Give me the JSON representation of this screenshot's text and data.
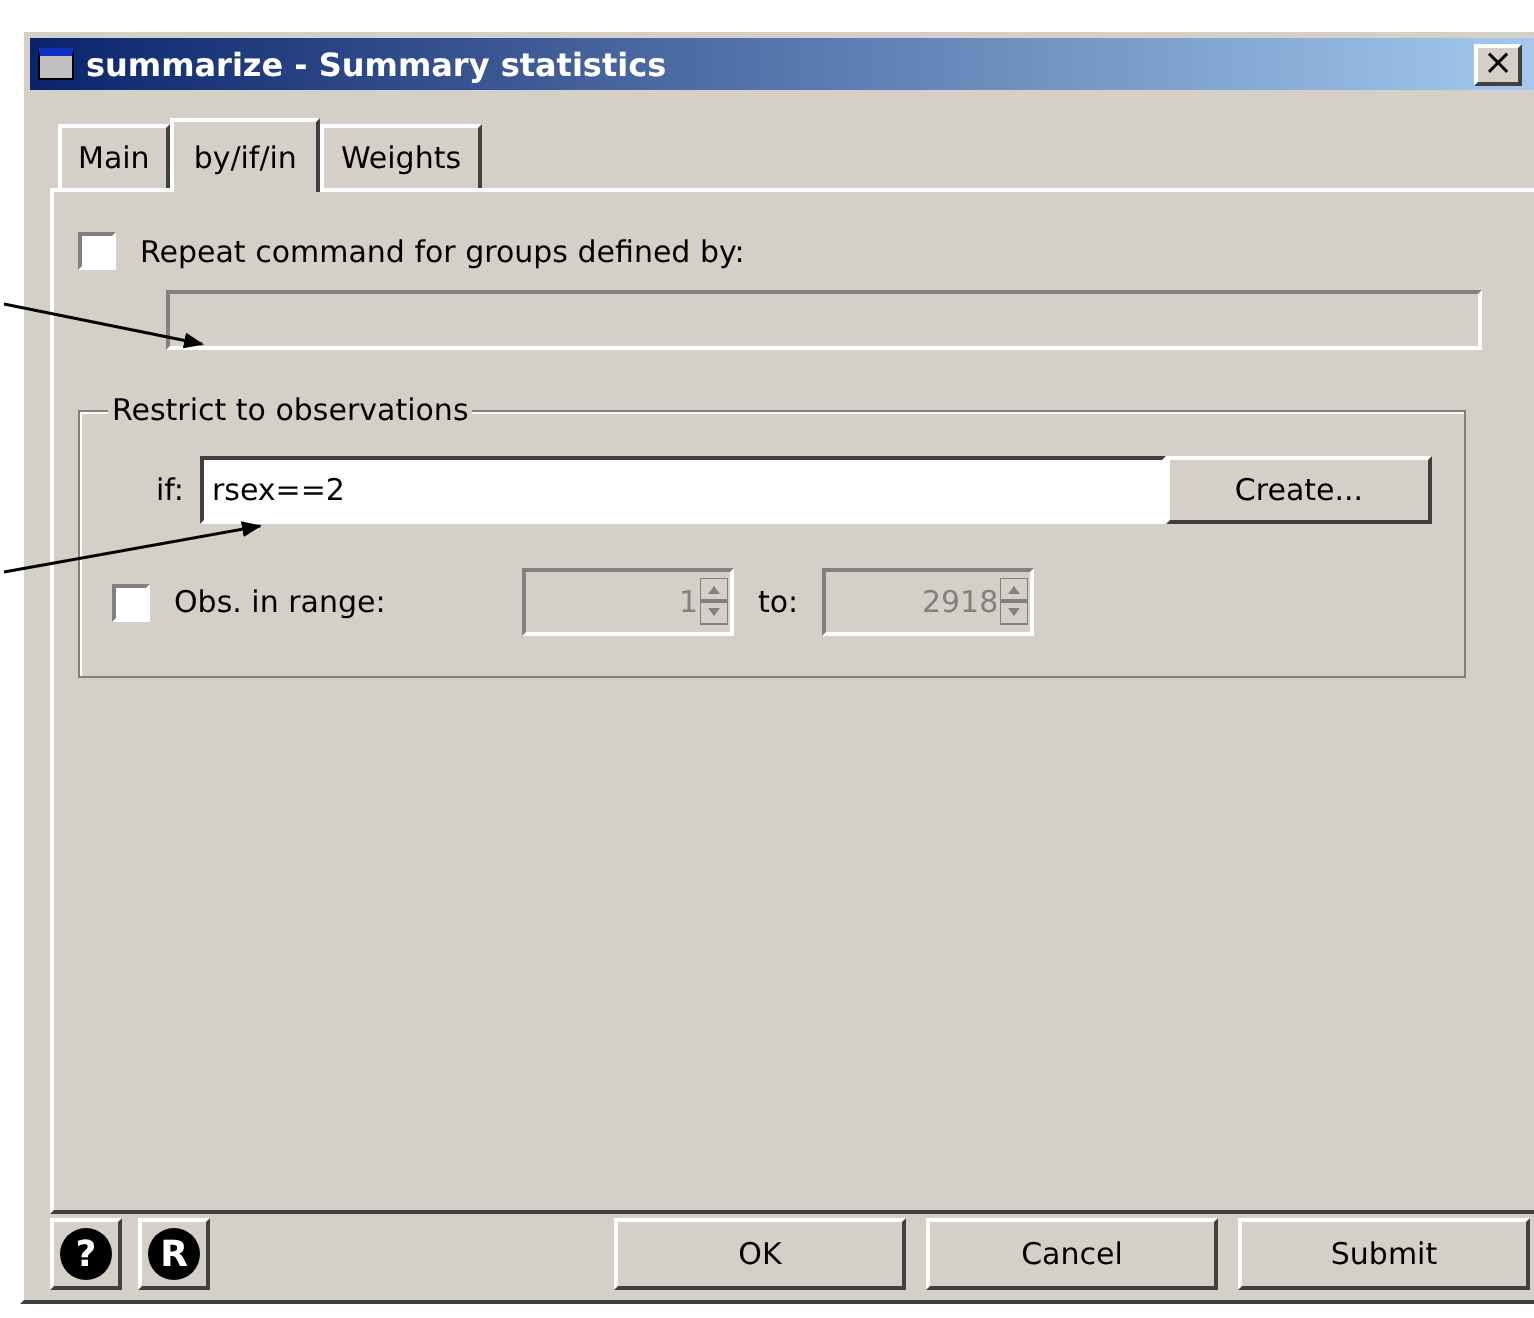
{
  "window": {
    "title": "summarize - Summary statistics",
    "close": "×"
  },
  "tabs": [
    {
      "label": "Main",
      "selected": false
    },
    {
      "label": "by/if/in",
      "selected": true
    },
    {
      "label": "Weights",
      "selected": false
    }
  ],
  "repeat": {
    "label": "Repeat command for groups defined by:",
    "checked": false,
    "disabled": true
  },
  "restrict": {
    "title": "Restrict to observations",
    "if_label": "if:",
    "if_value": "rsex==2",
    "create": "Create...",
    "range": {
      "label": "Obs. in range:",
      "checked": false,
      "from": {
        "value": "1",
        "disabled": true
      },
      "to_label": "to:",
      "to": {
        "value": "2918",
        "disabled": true
      }
    }
  },
  "footer": {
    "help": "?",
    "reset": "R",
    "buttons": [
      "OK",
      "Cancel",
      "Submit"
    ]
  }
}
